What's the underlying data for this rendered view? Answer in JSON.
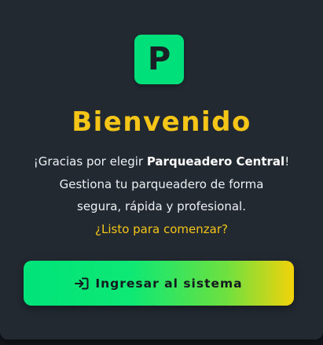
{
  "logo": {
    "letter": "P"
  },
  "welcome": {
    "title": "Bienvenido",
    "line1_prefix": "¡Gracias por elegir ",
    "brand": "Parqueadero Central",
    "line1_suffix": "!",
    "line2": "Gestiona tu parqueadero de forma",
    "line3": "segura, rápida y profesional.",
    "cta_text": "¿Listo para comenzar?"
  },
  "login_button": {
    "label": "Ingresar al sistema",
    "icon": "sign-in-icon"
  },
  "colors": {
    "accent_green": "#00e07a",
    "accent_yellow": "#f5c518",
    "card_bg": "#222931"
  }
}
